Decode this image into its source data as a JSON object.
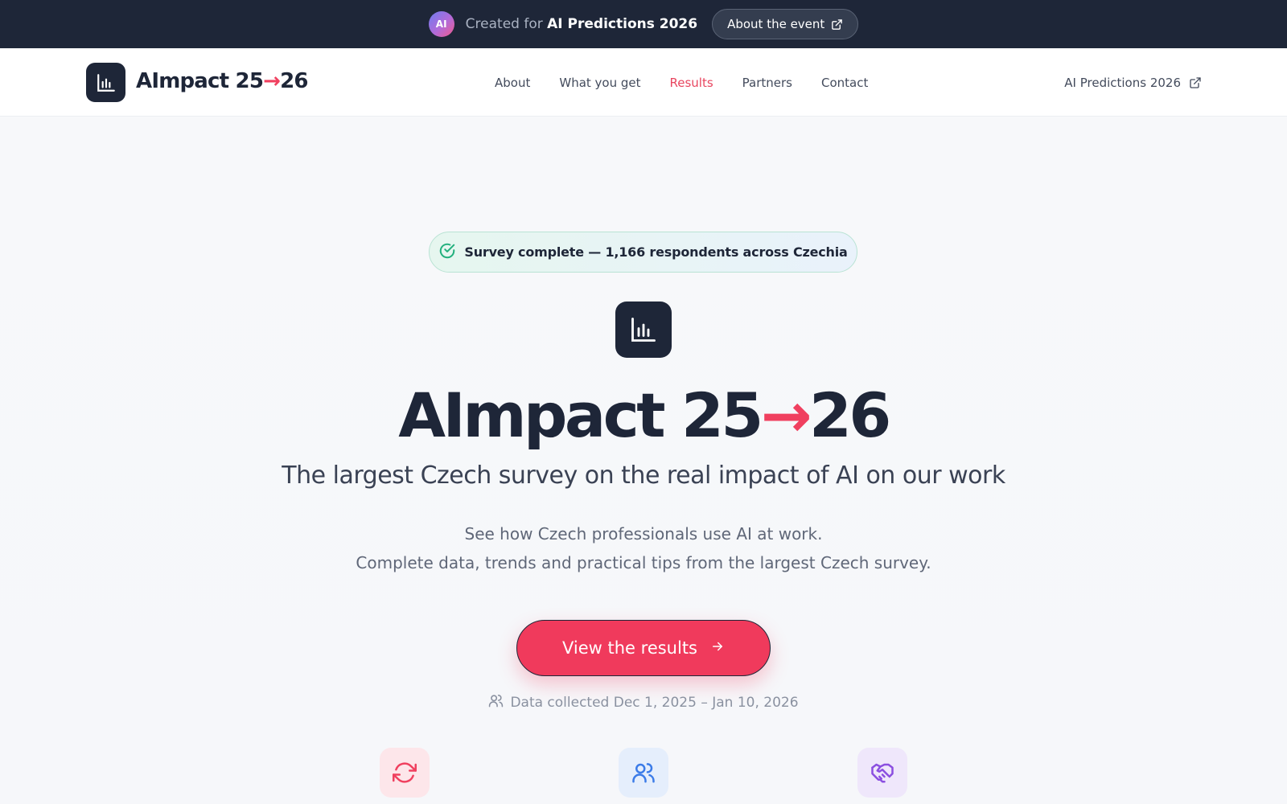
{
  "banner": {
    "badge": "AI",
    "created_prefix": "Created for",
    "created_event": "AI Predictions 2026",
    "about_button": "About the event"
  },
  "nav": {
    "brand_main": "AImpact 25",
    "brand_arrow": "→",
    "brand_end": "26",
    "links": [
      "About",
      "What you get",
      "Results",
      "Partners",
      "Contact"
    ],
    "active": "Results",
    "external_link": "AI Predictions 2026"
  },
  "hero": {
    "pill": "Survey complete — 1,166 respondents across Czechia",
    "title_main": "AImpact 25",
    "title_arrow": "→",
    "title_end": "26",
    "subtitle": "The largest Czech survey on the real impact of AI on our work",
    "desc_line1": "See how Czech professionals use AI at work.",
    "desc_line2": "Complete data, trends and practical tips from the largest Czech survey.",
    "cta": "View the results",
    "collected": "Data collected Dec 1, 2025 – Jan 10, 2026"
  },
  "colors": {
    "dark": "#1e2638",
    "accent": "#f03a5c",
    "success": "#22b07d"
  },
  "icons": [
    "bar-chart-icon",
    "check-circle-icon",
    "external-link-icon",
    "arrow-right-icon",
    "users-icon",
    "refresh-icon",
    "handshake-icon"
  ]
}
